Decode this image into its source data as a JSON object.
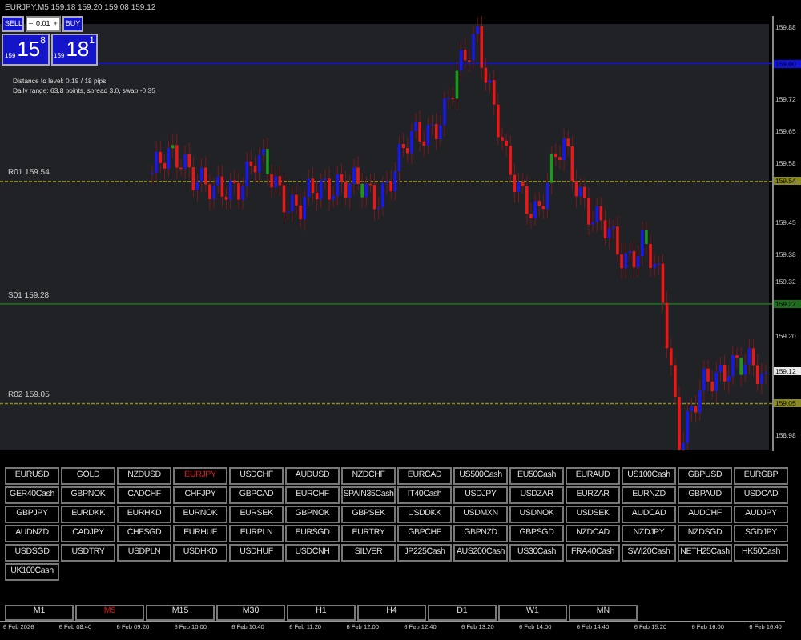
{
  "title": "EURJPY,M5 159.18 159.20 159.08 159.12",
  "trade_panel": {
    "sell_label": "SELL",
    "buy_label": "BUY",
    "lot": "0.01",
    "minus": "–",
    "plus": "+",
    "sell_price": {
      "prefix": "159",
      "big": "15",
      "sup": "8"
    },
    "buy_price": {
      "prefix": "159",
      "big": "18",
      "sup": "1"
    }
  },
  "info_lines": [
    "Distance to level: 0.18 / 18 pips",
    "Daily range: 63.8 points, spread 3.0, swap -0.35"
  ],
  "levels": [
    {
      "kind": "solid",
      "color": "#1010e0",
      "price": "159.80"
    },
    {
      "kind": "dashed",
      "color": "#8a8a20",
      "price": "159.54",
      "label": "R01  159.54"
    },
    {
      "kind": "solid",
      "color": "#1d6b1d",
      "price": "159.27",
      "label": "S01  159.28"
    },
    {
      "kind": "current",
      "color": "#e8e8e8",
      "price": "159.12"
    },
    {
      "kind": "dashed",
      "color": "#8a8a20",
      "price": "159.05",
      "label": "R02  159.05"
    }
  ],
  "price_ticks": [
    "159.88",
    "159.72",
    "159.65",
    "159.58",
    "159.45",
    "159.38",
    "159.32",
    "159.20",
    "158.98"
  ],
  "symbols": [
    {
      "label": "EURUSD",
      "selected": false
    },
    {
      "label": "GOLD",
      "selected": false
    },
    {
      "label": "NZDUSD",
      "selected": false
    },
    {
      "label": "EURJPY",
      "selected": true
    },
    {
      "label": "USDCHF",
      "selected": false
    },
    {
      "label": "AUDUSD",
      "selected": false
    },
    {
      "label": "NZDCHF",
      "selected": false
    },
    {
      "label": "EURCAD",
      "selected": false
    },
    {
      "label": "US500Cash",
      "selected": false
    },
    {
      "label": "EU50Cash",
      "selected": false
    },
    {
      "label": "EURAUD",
      "selected": false
    },
    {
      "label": "US100Cash",
      "selected": false
    },
    {
      "label": "GBPUSD",
      "selected": false
    },
    {
      "label": "EURGBP",
      "selected": false
    },
    {
      "label": "GER40Cash",
      "selected": false
    },
    {
      "label": "GBPNOK",
      "selected": false
    },
    {
      "label": "CADCHF",
      "selected": false
    },
    {
      "label": "CHFJPY",
      "selected": false
    },
    {
      "label": "GBPCAD",
      "selected": false
    },
    {
      "label": "EURCHF",
      "selected": false
    },
    {
      "label": "SPAIN35Cash",
      "selected": false
    },
    {
      "label": "IT40Cash",
      "selected": false
    },
    {
      "label": "USDJPY",
      "selected": false
    },
    {
      "label": "USDZAR",
      "selected": false
    },
    {
      "label": "EURZAR",
      "selected": false
    },
    {
      "label": "EURNZD",
      "selected": false
    },
    {
      "label": "GBPAUD",
      "selected": false
    },
    {
      "label": "USDCAD",
      "selected": false
    },
    {
      "label": "GBPJPY",
      "selected": false
    },
    {
      "label": "EURDKK",
      "selected": false
    },
    {
      "label": "EURHKD",
      "selected": false
    },
    {
      "label": "EURNOK",
      "selected": false
    },
    {
      "label": "EURSEK",
      "selected": false
    },
    {
      "label": "GBPNOK",
      "selected": false
    },
    {
      "label": "GBPSEK",
      "selected": false
    },
    {
      "label": "USDDKK",
      "selected": false
    },
    {
      "label": "USDMXN",
      "selected": false
    },
    {
      "label": "USDNOK",
      "selected": false
    },
    {
      "label": "USDSEK",
      "selected": false
    },
    {
      "label": "AUDCAD",
      "selected": false
    },
    {
      "label": "AUDCHF",
      "selected": false
    },
    {
      "label": "AUDJPY",
      "selected": false
    },
    {
      "label": "AUDNZD",
      "selected": false
    },
    {
      "label": "CADJPY",
      "selected": false
    },
    {
      "label": "CHFSGD",
      "selected": false
    },
    {
      "label": "EURHUF",
      "selected": false
    },
    {
      "label": "EURPLN",
      "selected": false
    },
    {
      "label": "EURSGD",
      "selected": false
    },
    {
      "label": "EURTRY",
      "selected": false
    },
    {
      "label": "GBPCHF",
      "selected": false
    },
    {
      "label": "GBPNZD",
      "selected": false
    },
    {
      "label": "GBPSGD",
      "selected": false
    },
    {
      "label": "NZDCAD",
      "selected": false
    },
    {
      "label": "NZDJPY",
      "selected": false
    },
    {
      "label": "NZDSGD",
      "selected": false
    },
    {
      "label": "SGDJPY",
      "selected": false
    },
    {
      "label": "USDSGD",
      "selected": false
    },
    {
      "label": "USDTRY",
      "selected": false
    },
    {
      "label": "USDPLN",
      "selected": false
    },
    {
      "label": "USDHKD",
      "selected": false
    },
    {
      "label": "USDHUF",
      "selected": false
    },
    {
      "label": "USDCNH",
      "selected": false
    },
    {
      "label": "SILVER",
      "selected": false
    },
    {
      "label": "JP225Cash",
      "selected": false
    },
    {
      "label": "AUS200Cash",
      "selected": false
    },
    {
      "label": "US30Cash",
      "selected": false
    },
    {
      "label": "FRA40Cash",
      "selected": false
    },
    {
      "label": "SWI20Cash",
      "selected": false
    },
    {
      "label": "NETH25Cash",
      "selected": false
    },
    {
      "label": "HK50Cash",
      "selected": false
    },
    {
      "label": "UK100Cash",
      "selected": false
    }
  ],
  "timeframes": [
    {
      "label": "M1",
      "selected": false
    },
    {
      "label": "M5",
      "selected": true
    },
    {
      "label": "M15",
      "selected": false
    },
    {
      "label": "M30",
      "selected": false
    },
    {
      "label": "H1",
      "selected": false
    },
    {
      "label": "H4",
      "selected": false
    },
    {
      "label": "D1",
      "selected": false
    },
    {
      "label": "W1",
      "selected": false
    },
    {
      "label": "MN",
      "selected": false
    }
  ],
  "time_axis": [
    "6 Feb 2026",
    "6 Feb 08:40",
    "6 Feb 09:20",
    "6 Feb 10:00",
    "6 Feb 10:40",
    "6 Feb 11:20",
    "6 Feb 12:00",
    "6 Feb 12:40",
    "6 Feb 13:20",
    "6 Feb 14:00",
    "6 Feb 14:40",
    "6 Feb 15:20",
    "6 Feb 16:00",
    "6 Feb 16:40"
  ]
}
